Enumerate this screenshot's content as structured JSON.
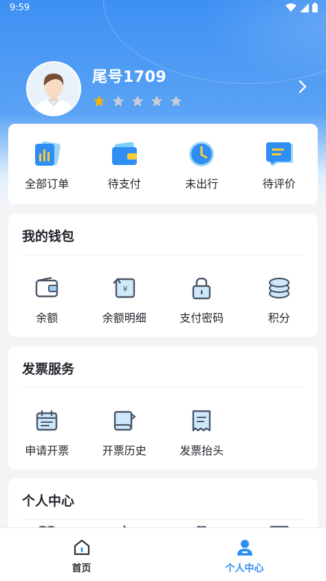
{
  "status_bar": {
    "time": "9:59"
  },
  "profile": {
    "name": "尾号1709",
    "rating": 1,
    "max_rating": 5
  },
  "orders": [
    {
      "label": "全部订单",
      "icon": "all-orders-icon"
    },
    {
      "label": "待支付",
      "icon": "wallet-card-icon"
    },
    {
      "label": "未出行",
      "icon": "clock-icon"
    },
    {
      "label": "待评价",
      "icon": "comment-icon"
    }
  ],
  "wallet": {
    "title": "我的钱包",
    "items": [
      {
        "label": "余额",
        "icon": "wallet-icon"
      },
      {
        "label": "余额明细",
        "icon": "balance-detail-icon"
      },
      {
        "label": "支付密码",
        "icon": "lock-icon"
      },
      {
        "label": "积分",
        "icon": "coins-icon"
      }
    ]
  },
  "invoice": {
    "title": "发票服务",
    "items": [
      {
        "label": "申请开票",
        "icon": "calendar-icon"
      },
      {
        "label": "开票历史",
        "icon": "invoice-history-icon"
      },
      {
        "label": "发票抬头",
        "icon": "receipt-icon"
      }
    ]
  },
  "personal": {
    "title": "个人中心"
  },
  "tabbar": {
    "items": [
      {
        "label": "首页",
        "icon": "home-icon",
        "active": false
      },
      {
        "label": "个人中心",
        "icon": "user-icon",
        "active": true
      }
    ]
  },
  "colors": {
    "primary": "#3d8ef5",
    "star_active": "#f5b50a",
    "star_inactive": "#c8ced6"
  }
}
